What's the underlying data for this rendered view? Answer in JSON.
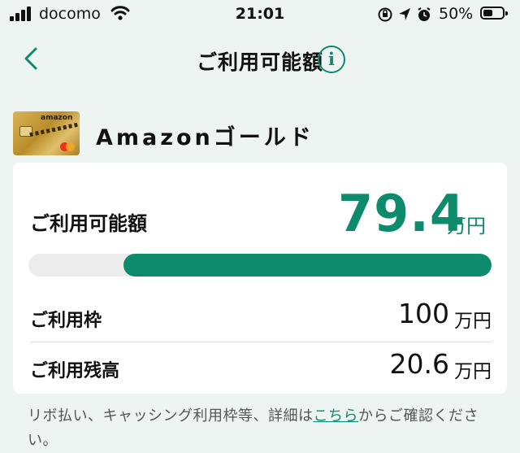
{
  "status_bar": {
    "carrier": "docomo",
    "time": "21:01",
    "battery_percent": "50%",
    "battery_level": 0.5,
    "icons": [
      "signal-icon",
      "wifi-icon",
      "orientation-lock-icon",
      "location-icon",
      "alarm-icon",
      "battery-icon"
    ]
  },
  "nav": {
    "back_icon": "chevron-left-icon",
    "title": "ご利用可能額",
    "info_icon": "i"
  },
  "card": {
    "name": "Amazonゴールド",
    "logo_text": "amazon"
  },
  "summary": {
    "available_label": "ご利用可能額",
    "available_value": "79.4",
    "available_unit": "万円",
    "available_fraction": 0.794,
    "limit_label": "ご利用枠",
    "limit_value": "100",
    "limit_unit": "万円",
    "balance_label": "ご利用残高",
    "balance_value": "20.6",
    "balance_unit": "万円"
  },
  "note": {
    "text_before": "リボ払い、キャッシング利用枠等、詳細は",
    "link": "こちら",
    "text_after": "からご確認ください。"
  },
  "colors": {
    "accent": "#0e8a6c",
    "background": "#eef4f1",
    "track": "#ececec"
  }
}
